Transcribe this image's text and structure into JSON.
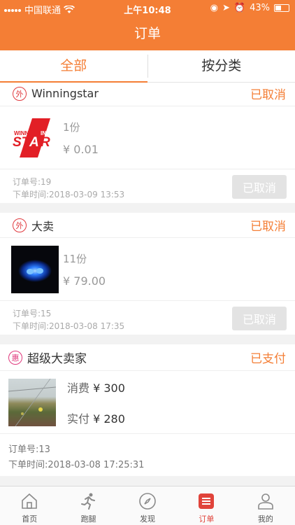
{
  "status_bar": {
    "carrier": "中国联通",
    "time": "上午10:48",
    "battery": "43%",
    "battery_level": 0.43
  },
  "header": {
    "title": "订单"
  },
  "tabs": [
    {
      "label": "全部",
      "active": true
    },
    {
      "label": "按分类",
      "active": false
    }
  ],
  "orders": [
    {
      "badge": "外",
      "shop": "Winningstar",
      "status": "已取消",
      "thumb_icon": "winningstar-logo",
      "qty": "1份",
      "price": "¥ 0.01",
      "order_no": "订单号:19",
      "order_time": "下单时间:2018-03-09 13:53",
      "action": "已取消"
    },
    {
      "badge": "外",
      "shop": "大卖",
      "status": "已取消",
      "thumb_icon": "blue-light-photo",
      "qty": "11份",
      "price": "¥ 79.00",
      "order_no": "订单号:15",
      "order_time": "下单时间:2018-03-08 17:35",
      "action": "已取消"
    },
    {
      "badge": "惠",
      "shop": "超级大卖家",
      "status": "已支付",
      "thumb_icon": "landscape-photo",
      "consume_label": "消费",
      "consume_value": "¥ 300",
      "paid_label": "实付",
      "paid_value": "¥ 280",
      "order_no": "订单号:13",
      "order_time": "下单时间:2018-03-08 17:25:31"
    }
  ],
  "tabbar": [
    {
      "label": "首页",
      "icon": "home-icon",
      "active": false
    },
    {
      "label": "跑腿",
      "icon": "runner-icon",
      "active": false
    },
    {
      "label": "发现",
      "icon": "compass-icon",
      "active": false
    },
    {
      "label": "订单",
      "icon": "orders-icon",
      "active": true
    },
    {
      "label": "我的",
      "icon": "profile-icon",
      "active": false
    }
  ],
  "colors": {
    "accent": "#f47e35",
    "badge_red": "#e0393e",
    "tab_active": "#e0433a",
    "disabled_button": "#e3e3e3"
  }
}
